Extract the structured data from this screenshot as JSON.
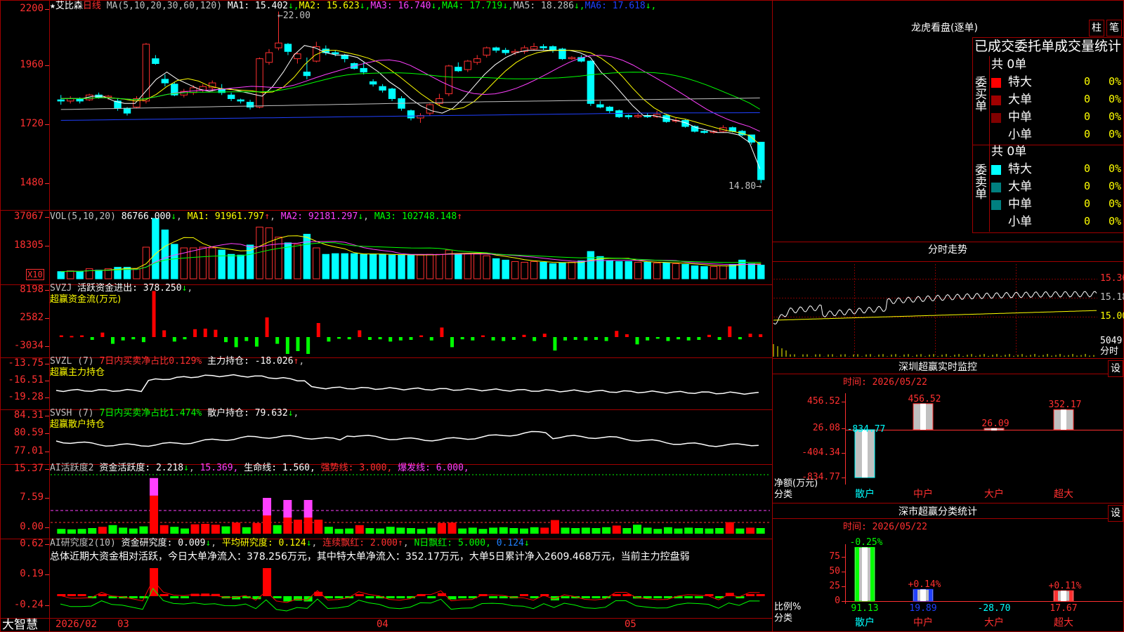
{
  "stock": {
    "star": "★",
    "name": "艾比森",
    "period": "日线"
  },
  "kline": {
    "ma_title": "MA(5,10,20,30,60,120)",
    "ma": [
      {
        "label": "MA1:",
        "value": "15.402",
        "arrow": "↓",
        "color": "#ffffff"
      },
      {
        "label": "MA2:",
        "value": "15.623",
        "arrow": "↓",
        "color": "#ffff00"
      },
      {
        "label": "MA3:",
        "value": "16.740",
        "arrow": "↓",
        "color": "#ff40ff"
      },
      {
        "label": "MA4:",
        "value": "17.719",
        "arrow": "↓",
        "color": "#00ff00"
      },
      {
        "label": "MA5:",
        "value": "18.286",
        "arrow": "↓",
        "color": "#c0c0c0"
      },
      {
        "label": "MA6:",
        "value": "17.618",
        "arrow": "↓",
        "color": "#2040ff"
      }
    ],
    "high_label": "22.00",
    "low_label": "14.80",
    "y_ticks": [
      "2200",
      "1960",
      "1720",
      "1480"
    ]
  },
  "vol": {
    "title": "VOL(5,10,20)",
    "value": "86766.000",
    "ma1": "MA1: 91961.797",
    "ma2": "MA2: 92181.297",
    "ma3": "MA3: 102748.148",
    "y_ticks": [
      "37067",
      "18305"
    ],
    "unit": "X10"
  },
  "svzj": {
    "title": "SVZJ",
    "label": "活跃资金进出:",
    "value": "378.250",
    "subtitle": "超赢资金流(万元)",
    "y_ticks": [
      "8198",
      "2582",
      "-3034"
    ]
  },
  "svzl": {
    "title": "SVZL (7)",
    "label1": "7日内买卖净占比0.129%",
    "label2": "主力持仓:",
    "value": "-18.026",
    "subtitle": "超赢主力持仓",
    "y_ticks": [
      "-13.75",
      "-16.51",
      "-19.28"
    ]
  },
  "svsh": {
    "title": "SVSH (7)",
    "label1": "7日内买卖净占比1.474%",
    "label2": "散户持仓:",
    "value": "79.632",
    "subtitle": "超赢散户持仓",
    "y_ticks": [
      "84.31",
      "80.59",
      "77.01"
    ]
  },
  "ai1": {
    "title": "AI活跃度2",
    "label": "资金活跃度:",
    "value": "2.218",
    "v2": "15.369,",
    "life": "生命线: 1.560,",
    "strong": "强势线: 3.000,",
    "burst": "爆发线: 6.000,",
    "y_ticks": [
      "15.37",
      "7.59",
      "0.00"
    ]
  },
  "ai2": {
    "title": "AI研究度2(10)",
    "label": "资金研究度: 0.009",
    "avg": "平均研究度: 0.124",
    "red": "连续飘红: 2.000",
    "nred": "N日飘红: 5.000,",
    "last": "0.124",
    "summary": "总体近期大资金相对活跃，今日大单净流入：378.256万元，其中特大单净流入：352.17万元，大单5日累计净入2609.468万元，当前主力控盘弱",
    "y_ticks": [
      "0.62",
      "0.19",
      "-0.24"
    ]
  },
  "x_axis": {
    "brand": "大智慧",
    "labels": [
      "2026/02",
      "03",
      "04",
      "05"
    ]
  },
  "right": {
    "dragon_title": "龙虎看盘(逐单)",
    "btn1": "柱",
    "btn2": "笔",
    "order_header": "已成交委托单成交量统计",
    "buy_side": "委买单",
    "sell_side": "委卖单",
    "buy_total": "共 0单",
    "sell_total": "共 0单",
    "buy_rows": [
      {
        "name": "特大",
        "count": "0",
        "pct": "0%",
        "color": "#ff0000"
      },
      {
        "name": "大单",
        "count": "0",
        "pct": "0%",
        "color": "#a00000"
      },
      {
        "name": "中单",
        "count": "0",
        "pct": "0%",
        "color": "#800000"
      },
      {
        "name": "小单",
        "count": "0",
        "pct": "0%",
        "color": "#000000"
      }
    ],
    "sell_rows": [
      {
        "name": "特大",
        "count": "0",
        "pct": "0%",
        "color": "#00ffff"
      },
      {
        "name": "大单",
        "count": "0",
        "pct": "0%",
        "color": "#008080"
      },
      {
        "name": "中单",
        "count": "0",
        "pct": "0%",
        "color": "#008080"
      },
      {
        "name": "小单",
        "count": "0",
        "pct": "0%",
        "color": "#000000"
      }
    ],
    "intraday_title": "分时走势",
    "intraday_ticks": [
      "15.36",
      "15.18",
      "15.00"
    ],
    "intraday_vol": "5049",
    "intraday_unit": "分时",
    "monitor_title": "深圳超赢实时监控",
    "monitor_btn": "设",
    "monitor_time": "时间: 2026/05/22",
    "monitor_ticks": [
      "456.52",
      "26.08",
      "-404.34",
      "-834.77"
    ],
    "monitor_axis_name": "净额(万元)",
    "monitor_cat_name": "分类",
    "monitor_cats": [
      "散户",
      "中户",
      "大户",
      "超大"
    ],
    "monitor_values": [
      "-834.77",
      "456.52",
      "26.09",
      "352.17"
    ],
    "class_title": "深市超赢分类统计",
    "class_btn": "设",
    "class_time": "时间: 2026/05/22",
    "class_ticks": [
      "75",
      "50",
      "25",
      "0"
    ],
    "class_axis_name": "比例%",
    "class_cat_name": "分类",
    "class_cats": [
      "散户",
      "中户",
      "大户",
      "超大"
    ],
    "class_top": [
      "-0.25%",
      "+0.14%",
      "",
      "+0.11%"
    ],
    "class_values": [
      "91.13",
      "19.89",
      "-28.70",
      "17.67"
    ]
  },
  "chart_data": {
    "type": "candlestick",
    "series_candles": [
      [
        18.25,
        18.2,
        18.45,
        18.05
      ],
      [
        18.2,
        18.3,
        18.4,
        18.1
      ],
      [
        18.3,
        18.2,
        18.35,
        18.1
      ],
      [
        18.25,
        18.45,
        18.5,
        18.2
      ],
      [
        18.45,
        18.35,
        18.55,
        18.3
      ],
      [
        18.35,
        18.4,
        18.45,
        18.25
      ],
      [
        18.2,
        17.9,
        18.3,
        17.8
      ],
      [
        17.9,
        17.7,
        17.95,
        17.6
      ],
      [
        17.95,
        18.3,
        18.4,
        17.9
      ],
      [
        18.2,
        20.55,
        20.6,
        18.1
      ],
      [
        19.95,
        19.75,
        20.1,
        19.7
      ],
      [
        19.1,
        18.95,
        19.3,
        18.8
      ],
      [
        18.9,
        18.45,
        19.0,
        18.4
      ],
      [
        18.45,
        18.6,
        18.7,
        18.35
      ],
      [
        18.55,
        18.75,
        18.85,
        18.45
      ],
      [
        18.65,
        18.8,
        18.9,
        18.55
      ],
      [
        18.75,
        18.95,
        19.05,
        18.6
      ],
      [
        18.7,
        18.55,
        18.9,
        18.45
      ],
      [
        18.45,
        18.3,
        18.55,
        18.2
      ],
      [
        18.25,
        18.2,
        18.3,
        18.1
      ],
      [
        18.15,
        17.95,
        18.25,
        17.85
      ],
      [
        17.95,
        19.95,
        20.0,
        17.9
      ],
      [
        19.8,
        20.2,
        20.35,
        19.7
      ],
      [
        20.4,
        20.6,
        21.9,
        20.3
      ],
      [
        20.55,
        20.25,
        20.6,
        20.1
      ],
      [
        19.95,
        20.15,
        20.2,
        19.75
      ],
      [
        19.4,
        19.25,
        20.0,
        19.1
      ],
      [
        19.85,
        20.45,
        20.65,
        19.8
      ],
      [
        20.35,
        20.2,
        20.5,
        20.1
      ],
      [
        20.2,
        20.15,
        20.3,
        20.05
      ],
      [
        20.1,
        19.95,
        20.15,
        19.8
      ],
      [
        19.75,
        19.55,
        19.8,
        19.5
      ],
      [
        19.55,
        19.4,
        19.8,
        19.3
      ],
      [
        19.0,
        18.9,
        19.1,
        18.8
      ],
      [
        18.8,
        18.65,
        18.9,
        18.55
      ],
      [
        18.7,
        18.3,
        18.75,
        18.2
      ],
      [
        18.3,
        17.9,
        18.4,
        17.8
      ],
      [
        17.8,
        17.5,
        17.85,
        17.4
      ],
      [
        17.5,
        17.6,
        17.7,
        17.3
      ],
      [
        17.7,
        18.05,
        18.1,
        17.6
      ],
      [
        18.1,
        18.3,
        18.5,
        18.0
      ],
      [
        18.5,
        19.65,
        19.7,
        18.4
      ],
      [
        19.6,
        19.45,
        19.8,
        19.4
      ],
      [
        19.5,
        19.85,
        19.9,
        19.4
      ],
      [
        19.8,
        19.95,
        20.1,
        19.7
      ],
      [
        20.1,
        20.4,
        20.45,
        20.0
      ],
      [
        20.4,
        20.3,
        20.45,
        20.2
      ],
      [
        20.3,
        20.2,
        20.4,
        20.1
      ],
      [
        20.2,
        20.25,
        20.35,
        20.1
      ],
      [
        20.25,
        20.4,
        20.5,
        20.15
      ],
      [
        20.35,
        20.45,
        20.6,
        20.3
      ],
      [
        20.45,
        20.4,
        20.55,
        20.3
      ],
      [
        20.45,
        20.3,
        20.5,
        20.2
      ],
      [
        20.35,
        19.95,
        20.4,
        19.9
      ],
      [
        19.95,
        20.0,
        20.05,
        19.9
      ],
      [
        20.0,
        19.85,
        20.1,
        19.8
      ],
      [
        19.85,
        18.1,
        19.9,
        18.0
      ],
      [
        18.05,
        17.95,
        18.2,
        17.9
      ],
      [
        17.95,
        17.8,
        18.0,
        17.7
      ],
      [
        17.8,
        17.55,
        17.85,
        17.5
      ],
      [
        17.6,
        17.55,
        17.65,
        17.45
      ],
      [
        17.55,
        17.6,
        17.7,
        17.5
      ],
      [
        17.6,
        17.55,
        17.7,
        17.5
      ],
      [
        17.55,
        17.65,
        17.8,
        17.5
      ],
      [
        17.6,
        17.35,
        17.65,
        17.3
      ],
      [
        17.4,
        17.4,
        17.5,
        17.3
      ],
      [
        17.4,
        17.15,
        17.45,
        17.1
      ],
      [
        17.15,
        16.95,
        17.2,
        16.9
      ],
      [
        16.95,
        16.9,
        17.0,
        16.85
      ],
      [
        16.9,
        16.95,
        17.0,
        16.85
      ],
      [
        16.95,
        17.1,
        17.2,
        16.9
      ],
      [
        17.1,
        16.95,
        17.15,
        16.9
      ],
      [
        16.95,
        16.8,
        17.0,
        16.75
      ],
      [
        16.8,
        16.5,
        16.8,
        16.4
      ],
      [
        16.5,
        14.95,
        15.0,
        14.8
      ]
    ],
    "ma_lines": {
      "ma1_approx": [
        18.3,
        18.3,
        18.3,
        18.4,
        18.4,
        18.2,
        18.1,
        18.1,
        18.6,
        19.1,
        19.4,
        19.1,
        18.9,
        18.7,
        18.6,
        18.7,
        18.7,
        18.6,
        18.5,
        18.4,
        18.8,
        19.4,
        20.1,
        20.5,
        20.4,
        20.2,
        20.1,
        20.1,
        20.0,
        19.7,
        19.4,
        19.0,
        18.7,
        18.3,
        18.0,
        17.8,
        17.7,
        17.9,
        18.3,
        18.8,
        19.3,
        19.7,
        20.0,
        20.2,
        20.3,
        20.3,
        20.3,
        20.3,
        20.3,
        20.2,
        20.0,
        19.4,
        19.0,
        18.5,
        18.0,
        17.6,
        17.6,
        17.5,
        17.4,
        17.3,
        17.1,
        17.0,
        16.9,
        16.9,
        16.8,
        16.5,
        15.4
      ]
    },
    "volume": [
      1.0,
      1.1,
      1.0,
      1.4,
      1.2,
      1.4,
      1.6,
      1.6,
      1.4,
      4.4,
      8.4,
      6.8,
      4.8,
      4.3,
      4.3,
      4.4,
      4.3,
      4.0,
      3.4,
      3.3,
      4.7,
      7.2,
      7.1,
      5.8,
      5.0,
      4.8,
      6.2,
      4.3,
      3.4,
      3.5,
      3.5,
      3.5,
      3.4,
      3.4,
      3.4,
      3.3,
      3.3,
      3.3,
      3.3,
      3.4,
      3.4,
      4.0,
      3.5,
      3.5,
      3.5,
      3.2,
      2.8,
      2.6,
      2.4,
      2.3,
      2.4,
      2.3,
      2.1,
      2.2,
      2.3,
      2.5,
      3.8,
      3.1,
      2.5,
      2.4,
      2.4,
      2.3,
      2.3,
      2.2,
      2.2,
      2.1,
      2.0,
      1.8,
      1.7,
      1.7,
      1.8,
      2.0,
      2.6,
      2.1,
      1.9
    ],
    "fund_flow": [
      0.3,
      0.2,
      0.3,
      -0.5,
      0.8,
      -1.2,
      -0.6,
      -0.4,
      -0.9,
      8.2,
      1.2,
      -0.8,
      -0.4,
      1.4,
      1.5,
      1.3,
      -0.9,
      -1.8,
      -0.7,
      -1.7,
      3.5,
      -1.2,
      -3.0,
      -2.5,
      -3.0,
      2.5,
      -0.8,
      -0.3,
      -0.4,
      1.2,
      -0.5,
      -0.4,
      -0.8,
      -0.6,
      -0.5,
      0.3,
      -0.6,
      1.7,
      -1.8,
      -0.4,
      -0.6,
      0.3,
      -0.6,
      -0.7,
      -0.5,
      0.4,
      -0.7,
      0.6,
      -2.4,
      -0.6,
      -0.5,
      -0.6,
      -0.5,
      -0.7,
      1.1,
      0.5,
      -1.3,
      -0.6,
      -0.3,
      -0.7,
      -0.4,
      -0.6,
      -0.5,
      0.4,
      -0.5,
      1.9,
      -0.4,
      0.6,
      0.5
    ]
  }
}
